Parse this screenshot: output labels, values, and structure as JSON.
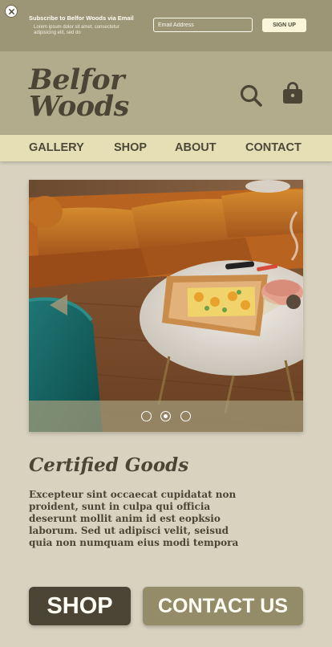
{
  "banner": {
    "title": "Subscribe to Belfor Woods via Email",
    "subtitle": "Lorem ipsum dolor sit amet, consectetur adipisicing elit, sed do",
    "email_placeholder": "Email Address",
    "signup_label": "SIGN UP",
    "close_icon": "close-icon"
  },
  "header": {
    "logo_line1": "Belfor",
    "logo_line2": "Woods",
    "search_icon": "search-icon",
    "bag_icon": "shopping-bag-icon"
  },
  "nav": {
    "items": [
      {
        "label": "GALLERY"
      },
      {
        "label": "SHOP"
      },
      {
        "label": "ABOUT"
      },
      {
        "label": "CONTACT"
      }
    ]
  },
  "carousel": {
    "slide_count": 3,
    "active_index": 1
  },
  "section": {
    "title": "Certified Goods",
    "body": "Excepteur sint occaecat cupidatat non proident, sunt in culpa qui officia deserunt mollit anim id est eopksio laborum. Sed ut adipisci velit, seisud quia non numquam eius modi tempora"
  },
  "buttons": {
    "shop": "SHOP",
    "contact": "CONTACT US"
  },
  "colors": {
    "banner": "#9c9576",
    "header": "#b3ac8c",
    "nav": "#e6dfb6",
    "page": "#d8d2bf",
    "dark": "#4c4536",
    "olive_button": "#948c69"
  }
}
